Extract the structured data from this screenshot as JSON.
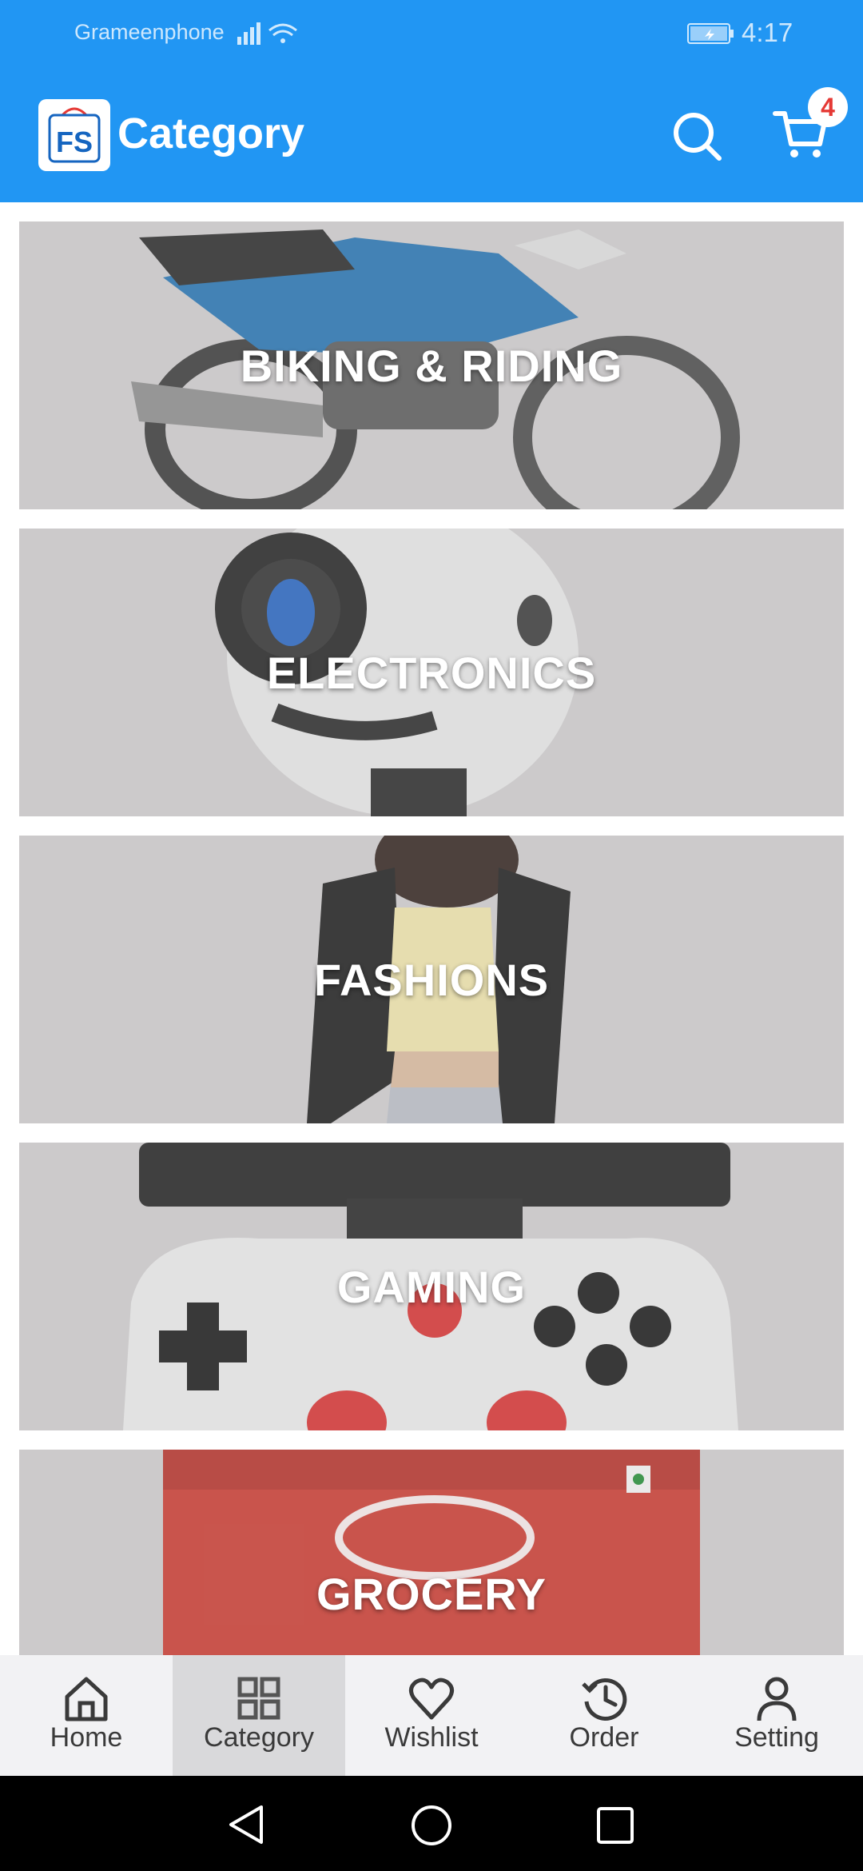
{
  "status_bar": {
    "carrier": "Grameenphone",
    "time": "4:17"
  },
  "app_bar": {
    "logo_text": "FS",
    "title": "Category",
    "cart_count": "4"
  },
  "categories": [
    {
      "label": "BIKING & RIDING"
    },
    {
      "label": "ELECTRONICS"
    },
    {
      "label": "FASHIONS"
    },
    {
      "label": "GAMING"
    },
    {
      "label": "GROCERY"
    }
  ],
  "bottom_nav": [
    {
      "label": "Home",
      "icon": "home-icon"
    },
    {
      "label": "Category",
      "icon": "grid-icon",
      "active": true
    },
    {
      "label": "Wishlist",
      "icon": "heart-icon"
    },
    {
      "label": "Order",
      "icon": "history-icon"
    },
    {
      "label": "Setting",
      "icon": "person-icon"
    }
  ],
  "colors": {
    "primary": "#2196f3",
    "badge_text": "#e53935",
    "card_bg": "#cdcbcc"
  }
}
